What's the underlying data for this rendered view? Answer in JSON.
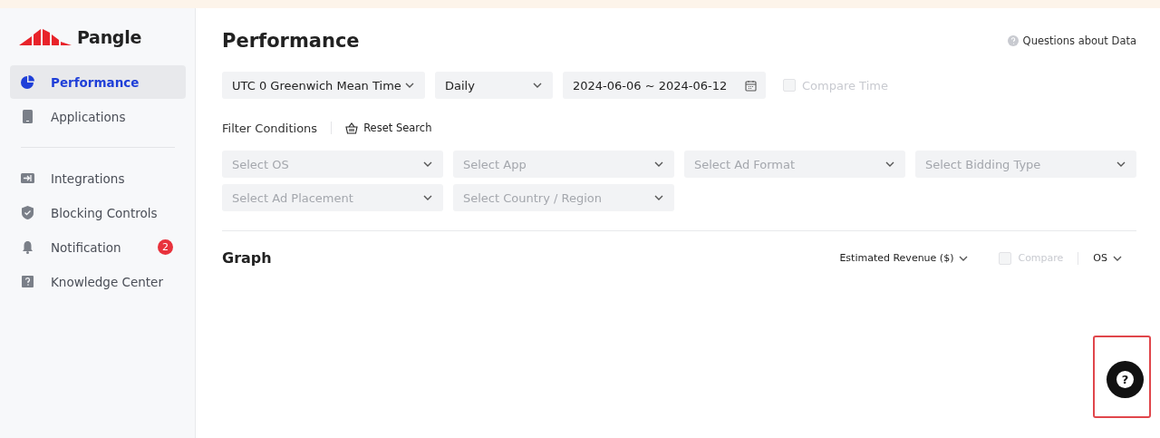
{
  "sidebar": {
    "logo": "Pangle",
    "groups": [
      [
        {
          "label": "Performance",
          "selected": true
        },
        {
          "label": "Applications",
          "selected": false
        }
      ],
      [
        {
          "label": "Integrations",
          "selected": false
        },
        {
          "label": "Blocking Controls",
          "selected": false
        },
        {
          "label": "Notification",
          "selected": false,
          "badge": "2"
        },
        {
          "label": "Knowledge Center",
          "selected": false
        }
      ]
    ]
  },
  "header": {
    "title": "Performance",
    "help_link": "Questions about Data"
  },
  "controls": [
    {
      "kind": "select",
      "value": "UTC 0 Greenwich Mean Time"
    },
    {
      "kind": "select",
      "value": "Daily"
    },
    {
      "kind": "date",
      "value": "2024-06-06 ~ 2024-06-12"
    },
    {
      "kind": "checkbox",
      "label": "Compare Time",
      "checked": false,
      "disabled": true
    }
  ],
  "filters": {
    "label": "Filter Conditions",
    "reset": "Reset Search",
    "selects": [
      {
        "placeholder": "Select OS"
      },
      {
        "placeholder": "Select App"
      },
      {
        "placeholder": "Select Ad Format"
      },
      {
        "placeholder": "Select Bidding Type"
      },
      {
        "placeholder": "Select Ad Placement"
      },
      {
        "placeholder": "Select Country / Region"
      }
    ]
  },
  "graph": {
    "title": "Graph",
    "metric": "Estimated Revenue ($)",
    "compare": {
      "label": "Compare",
      "checked": false,
      "disabled": true
    },
    "dimension": "OS"
  },
  "help_button": {
    "label": "?",
    "highlighted": true
  }
}
